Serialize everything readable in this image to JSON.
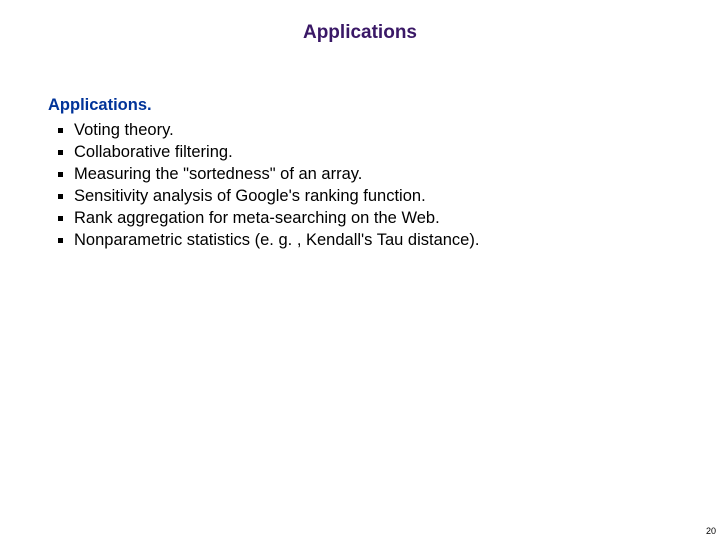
{
  "title": "Applications",
  "heading": "Applications.",
  "bullets": [
    "Voting theory.",
    "Collaborative filtering.",
    "Measuring the \"sortedness\" of an array.",
    "Sensitivity analysis of Google's ranking function.",
    "Rank aggregation for meta-searching on the Web.",
    "Nonparametric statistics  (e. g. , Kendall's Tau distance)."
  ],
  "page_number": "20"
}
